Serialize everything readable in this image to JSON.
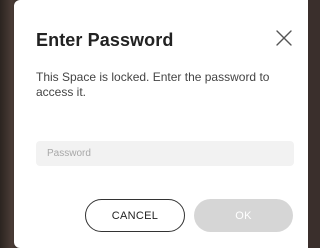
{
  "dialog": {
    "title": "Enter Password",
    "message": "This Space is locked. Enter the password to access it.",
    "password_field": {
      "value": "",
      "placeholder": "Password"
    },
    "cancel_label": "CANCEL",
    "ok_label": "OK",
    "close_icon": "close-icon"
  },
  "colors": {
    "ok_disabled_bg": "#d6d6d6",
    "title_text": "#222222"
  }
}
